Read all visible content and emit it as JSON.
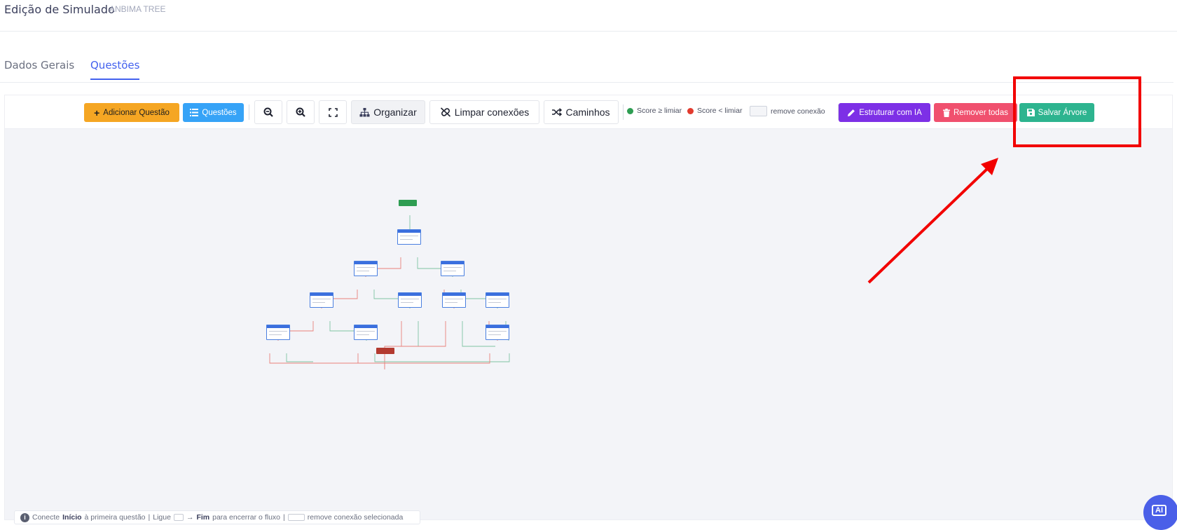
{
  "header": {
    "title": "Edição de Simulado",
    "subtitle": "ANBIMA TREE"
  },
  "tabs": [
    {
      "label": "Dados Gerais",
      "active": false
    },
    {
      "label": "Questões",
      "active": true
    }
  ],
  "toolbar": {
    "add_question": "Adicionar Questão",
    "questions": "Questões",
    "organize": "Organizar",
    "clear_connections": "Limpar conexões",
    "paths": "Caminhos",
    "legend_above": "Score ≥ limiar",
    "legend_below": "Score < limiar",
    "legend_remove": "remove conexão",
    "structure_ai": "Estruturar com IA",
    "remove_all": "Remover todas",
    "save_tree": "Salvar Árvore",
    "icons": [
      "plus-icon",
      "list-icon",
      "zoom-out-icon",
      "zoom-in-icon",
      "fullscreen-icon",
      "sitemap-icon",
      "unlink-icon",
      "shuffle-icon",
      "pencil-icon",
      "trash-icon",
      "save-icon"
    ]
  },
  "colors": {
    "accent": "#4361ee",
    "add": "#f5a623",
    "questions": "#36a3f7",
    "ai": "#7d30e6",
    "remove": "#f0506e",
    "save": "#2db48f",
    "score_above": "#2e9d52",
    "score_below": "#e23b2e",
    "annotation": "#f20000"
  },
  "hint": {
    "prefix": "Conecte",
    "start": "Início",
    "mid1": "à primeira questão",
    "sep1": "|",
    "link": "Ligue",
    "arrow": "→",
    "end": "Fim",
    "mid2": "para encerrar o fluxo",
    "sep2": "|",
    "remove": "remove conexão selecionada"
  },
  "fab": {
    "label": "AI"
  }
}
